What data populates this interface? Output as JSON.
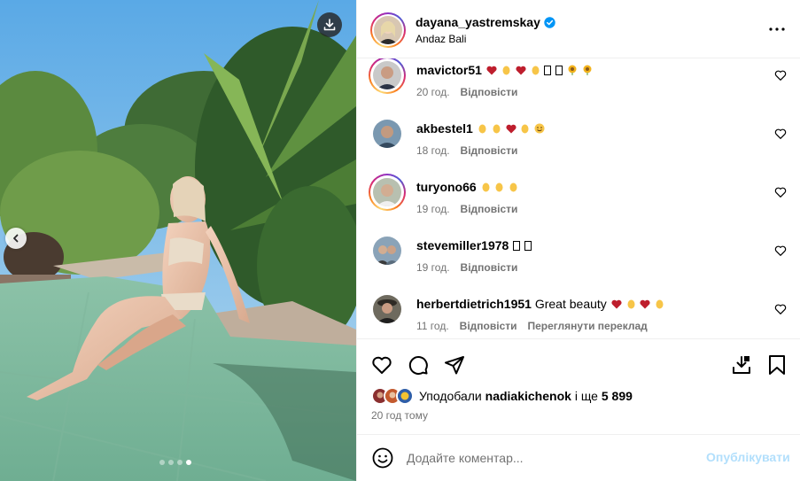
{
  "post": {
    "author": "dayana_yastremskay",
    "verified": true,
    "location": "Andaz Bali",
    "carousel": {
      "slides": 4,
      "current_slide": 4
    }
  },
  "comments": [
    {
      "user": "mavictor51",
      "text": "",
      "emojis": [
        "heart",
        "clap",
        "heart",
        "clap",
        "box",
        "box",
        "sunflower",
        "sunflower"
      ],
      "time": "20 год.",
      "reply": "Відповісти",
      "has_story_ring": true
    },
    {
      "user": "akbestel1",
      "text": "",
      "emojis": [
        "clap",
        "clap",
        "heart",
        "clap",
        "smile"
      ],
      "time": "18 год.",
      "reply": "Відповісти",
      "has_story_ring": false
    },
    {
      "user": "turyono66",
      "text": "",
      "emojis": [
        "clap",
        "clap",
        "clap"
      ],
      "time": "19 год.",
      "reply": "Відповісти",
      "has_story_ring": true
    },
    {
      "user": "stevemiller1978",
      "text": "",
      "emojis": [
        "box",
        "box"
      ],
      "time": "19 год.",
      "reply": "Відповісти",
      "has_story_ring": false
    },
    {
      "user": "herbertdietrich1951",
      "text": "Great beauty",
      "emojis": [
        "heart",
        "clap",
        "heart",
        "clap"
      ],
      "time": "11 год.",
      "reply": "Відповісти",
      "translate": "Переглянути переклад",
      "has_story_ring": false
    }
  ],
  "likes": {
    "prefix": "Уподобали",
    "user": "nadiakichenok",
    "middle": "і ще",
    "count": "5 899"
  },
  "time_ago": "20 год тому",
  "comment_input": {
    "placeholder": "Додайте коментар...",
    "value": ""
  },
  "post_button": "Опублікувати",
  "colors": {
    "accent": "#0095f6",
    "post_disabled": "#b2dffc",
    "secondary_text": "#737373",
    "heart": "#be1e2d",
    "clap": "#f7c548",
    "verified": "#0095f6"
  },
  "icons": {
    "download": "download-icon",
    "prev": "chevron-left-icon",
    "more": "more-horizontal-icon",
    "like": "heart-outline-icon",
    "comment": "speech-bubble-icon",
    "share": "paper-plane-icon",
    "save_download": "download-tray-icon",
    "bookmark": "bookmark-icon",
    "emoji": "smiley-icon"
  }
}
